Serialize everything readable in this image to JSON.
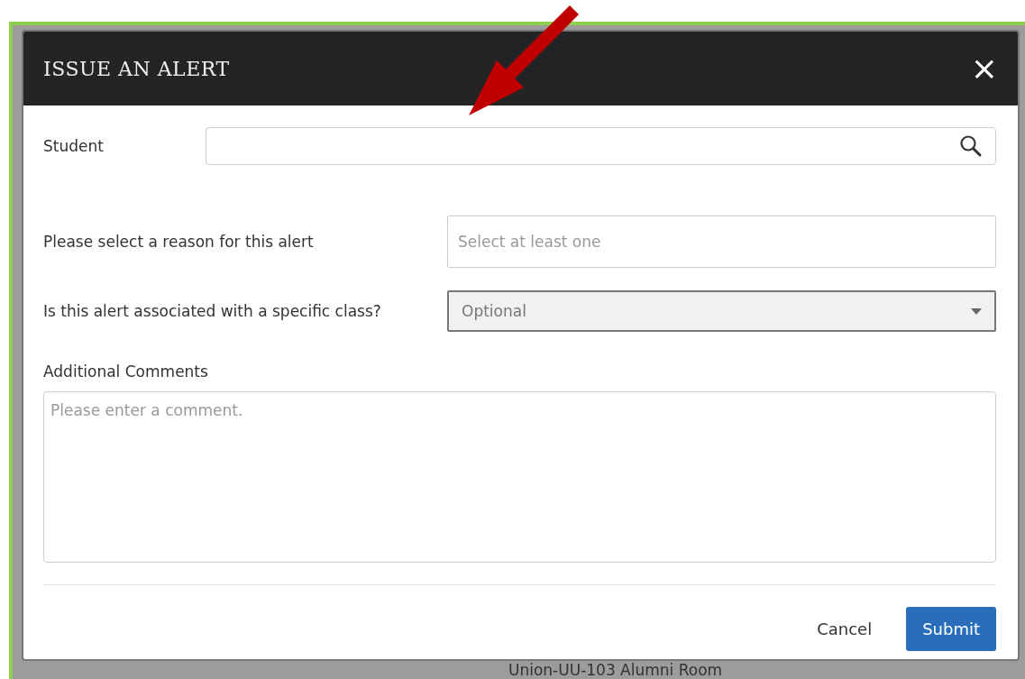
{
  "dialog": {
    "title": "ISSUE AN ALERT",
    "close": "×"
  },
  "fields": [
    {
      "kind": "search",
      "label": "Student"
    },
    {
      "kind": "multiselect",
      "label": "Please select a reason for this alert",
      "placeholder": "Select at least one"
    },
    {
      "kind": "dropdown",
      "label": "Is this alert associated with a specific class?",
      "placeholder": "Optional"
    },
    {
      "kind": "textarea",
      "label": "Additional Comments",
      "placeholder": "Please enter a comment."
    }
  ],
  "buttons": [
    {
      "label": "Cancel",
      "kind": "secondary"
    },
    {
      "label": "Submit",
      "kind": "primary"
    }
  ],
  "background": {
    "text": "Union-UU-103 Alumni Room"
  }
}
